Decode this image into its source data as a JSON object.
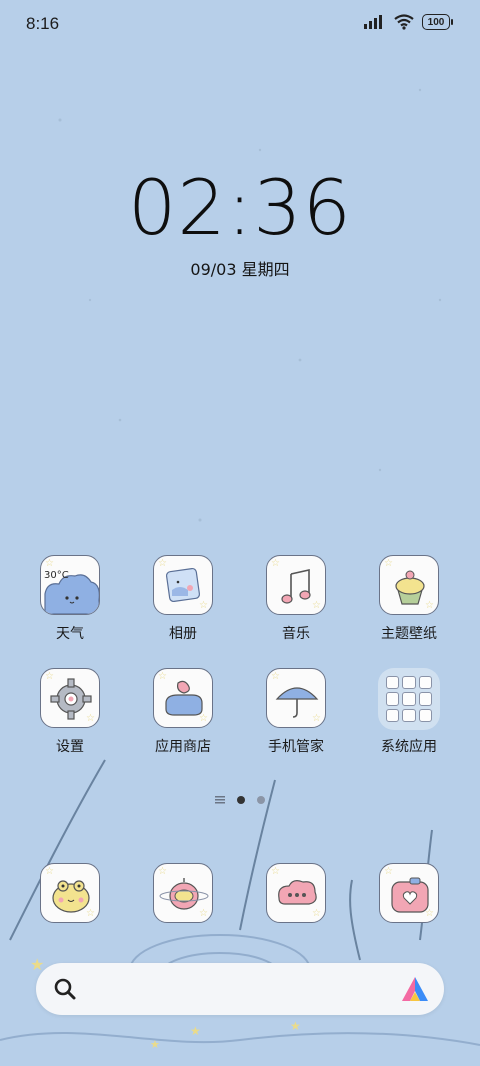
{
  "status_bar": {
    "time": "8:16",
    "battery": "100"
  },
  "lockclock": {
    "time": "02:36",
    "date": "09/03 星期四"
  },
  "apps": {
    "row1": [
      {
        "label": "天气",
        "icon": "weather-cloud-icon",
        "temp": "30°C"
      },
      {
        "label": "相册",
        "icon": "gallery-icon"
      },
      {
        "label": "音乐",
        "icon": "music-note-icon"
      },
      {
        "label": "主题壁纸",
        "icon": "cupcake-icon"
      }
    ],
    "row2": [
      {
        "label": "设置",
        "icon": "gear-icon"
      },
      {
        "label": "应用商店",
        "icon": "app-store-bag-icon"
      },
      {
        "label": "手机管家",
        "icon": "umbrella-icon"
      },
      {
        "label": "系统应用",
        "icon": "folder-icon"
      }
    ]
  },
  "dock": [
    {
      "icon": "frog-icon"
    },
    {
      "icon": "apple-icon"
    },
    {
      "icon": "message-cloud-icon"
    },
    {
      "icon": "camera-icon"
    }
  ],
  "colors": {
    "wallpaper": "#b7cfe9",
    "icon_border": "#6a7388",
    "accent_pink": "#f2a6b4",
    "accent_blue": "#8fb0e3",
    "accent_yellow": "#f3e38f"
  }
}
